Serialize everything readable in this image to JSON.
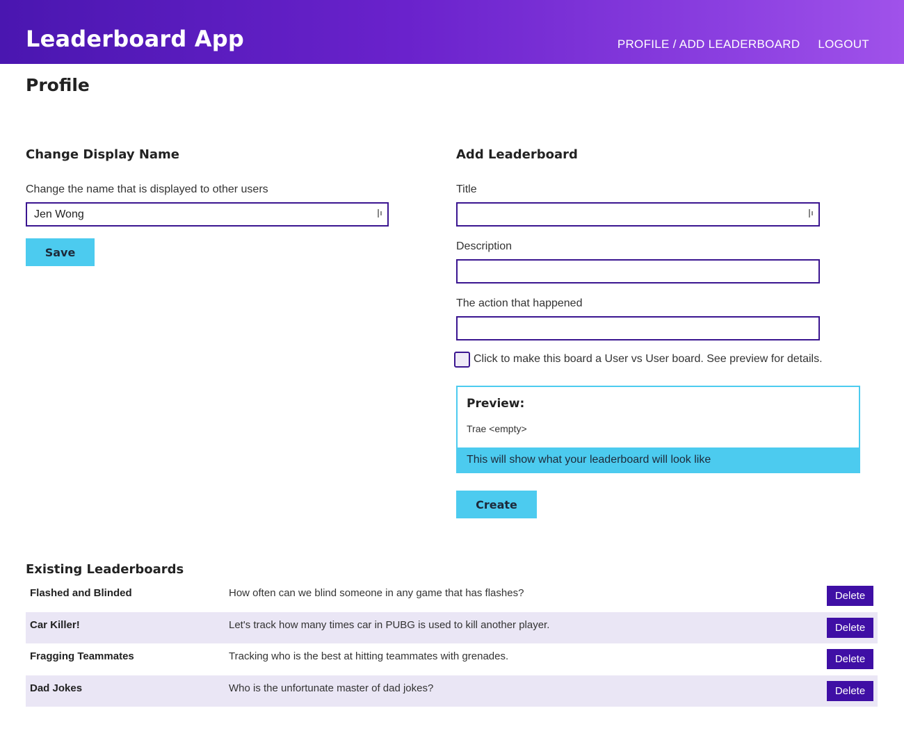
{
  "header": {
    "app_title": "Leaderboard App",
    "nav": {
      "profile_add": "PROFILE / ADD LEADERBOARD",
      "logout": "LOGOUT"
    }
  },
  "page": {
    "title": "Profile"
  },
  "display_name": {
    "section_title": "Change Display Name",
    "label": "Change the name that is displayed to other users",
    "value": "Jen Wong",
    "save_label": "Save"
  },
  "add_leaderboard": {
    "section_title": "Add Leaderboard",
    "title_label": "Title",
    "title_value": "",
    "description_label": "Description",
    "description_value": "",
    "action_label": "The action that happened",
    "action_value": "",
    "checkbox_label": "Click to make this board a User vs User board. See preview for details.",
    "checkbox_checked": false,
    "preview": {
      "heading": "Preview:",
      "text": "Trae <empty>",
      "footer": "This will show what your leaderboard will look like"
    },
    "create_label": "Create"
  },
  "existing": {
    "section_title": "Existing Leaderboards",
    "delete_label": "Delete",
    "rows": [
      {
        "name": "Flashed and Blinded",
        "description": "How often can we blind someone in any game that has flashes?"
      },
      {
        "name": "Car Killer!",
        "description": "Let's track how many times car in PUBG is used to kill another player."
      },
      {
        "name": "Fragging Teammates",
        "description": "Tracking who is the best at hitting teammates with grenades."
      },
      {
        "name": "Dad Jokes",
        "description": "Who is the unfortunate master of dad jokes?"
      }
    ]
  },
  "colors": {
    "header_start": "#4a16b0",
    "header_end": "#a052ea",
    "accent_cyan": "#4ccbef",
    "input_border": "#3a1590",
    "delete_button": "#3f0fa5",
    "row_alt": "#eae6f5"
  }
}
